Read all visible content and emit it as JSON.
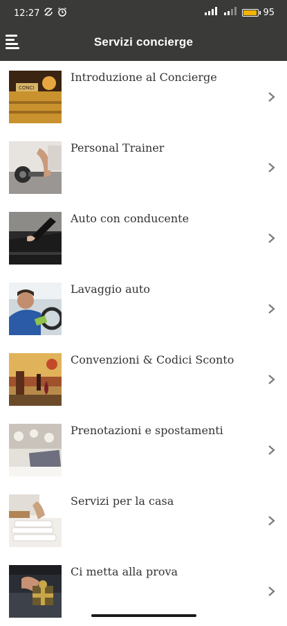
{
  "status_bar": {
    "time": "12:27",
    "battery": "95"
  },
  "header": {
    "title": "Servizi concierge",
    "menu_icon": "hamburger-menu-icon"
  },
  "items": [
    {
      "label": "Introduzione al Concierge",
      "icon": "chevron-right-icon"
    },
    {
      "label": "Personal Trainer",
      "icon": "chevron-right-icon"
    },
    {
      "label": "Auto con conducente",
      "icon": "chevron-right-icon"
    },
    {
      "label": "Lavaggio auto",
      "icon": "chevron-right-icon"
    },
    {
      "label": "Convenzioni & Codici Sconto",
      "icon": "chevron-right-icon"
    },
    {
      "label": "Prenotazioni e spostamenti",
      "icon": "chevron-right-icon"
    },
    {
      "label": "Servizi per la casa",
      "icon": "chevron-right-icon"
    },
    {
      "label": "Ci metta alla prova",
      "icon": "chevron-right-icon"
    }
  ],
  "colors": {
    "bar": "#3a3a38",
    "text": "#333333",
    "battery_fill": "#f2b400"
  }
}
